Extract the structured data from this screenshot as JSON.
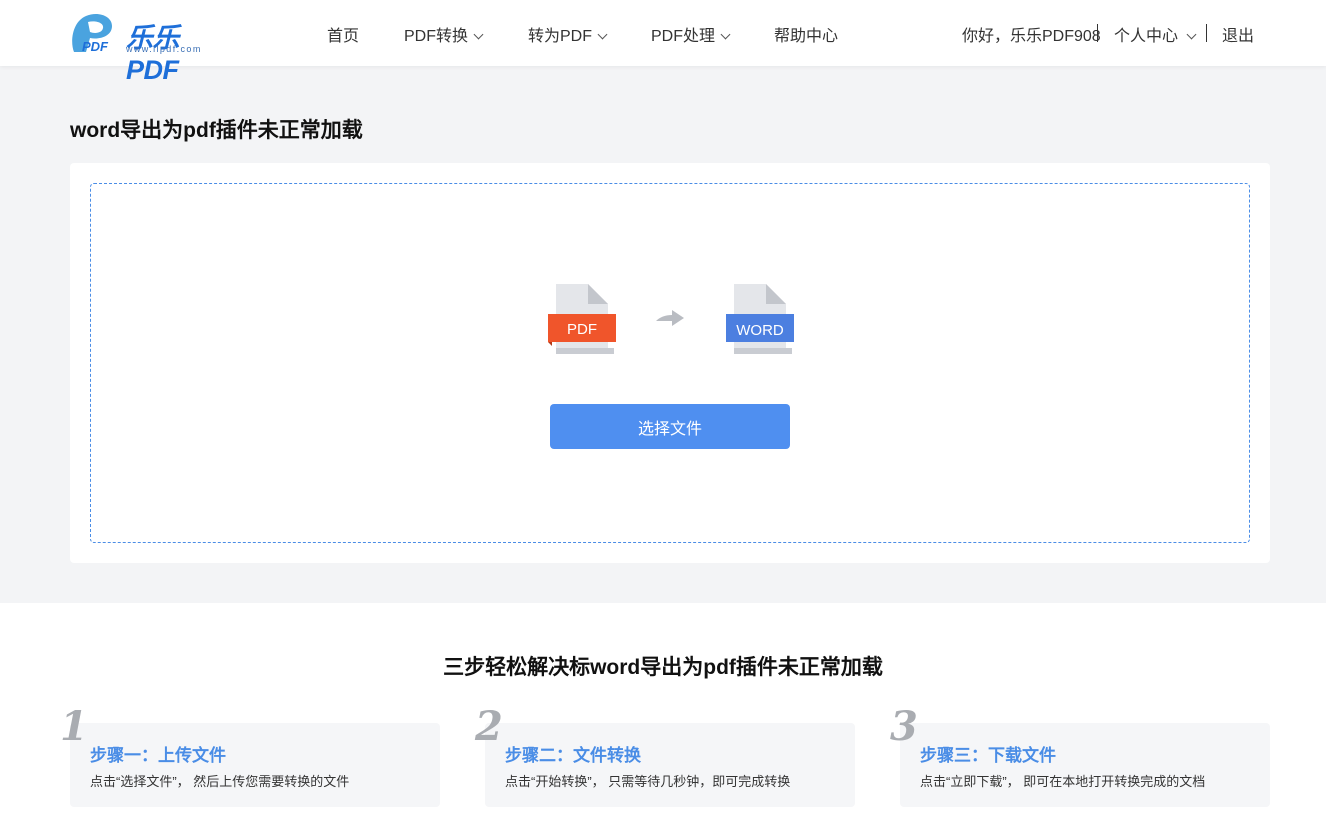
{
  "header": {
    "logo_text": "乐乐PDF",
    "logo_url": "www.llpdf.com",
    "nav": [
      {
        "label": "首页",
        "has_dropdown": false
      },
      {
        "label": "PDF转换",
        "has_dropdown": true
      },
      {
        "label": "转为PDF",
        "has_dropdown": true
      },
      {
        "label": "PDF处理",
        "has_dropdown": true
      },
      {
        "label": "帮助中心",
        "has_dropdown": false
      }
    ],
    "greeting": "你好，乐乐PDF908",
    "user_center": "个人中心",
    "logout": "退出"
  },
  "main": {
    "title": "word导出为pdf插件未正常加载",
    "source_label": "PDF",
    "target_label": "WORD",
    "select_button": "选择文件"
  },
  "steps": {
    "title": "三步轻松解决标word导出为pdf插件未正常加载",
    "items": [
      {
        "num": "1",
        "title": "步骤一：上传文件",
        "desc": "点击“选择文件”， 然后上传您需要转换的文件"
      },
      {
        "num": "2",
        "title": "步骤二：文件转换",
        "desc": "点击“开始转换”， 只需等待几秒钟，即可完成转换"
      },
      {
        "num": "3",
        "title": "步骤三：下载文件",
        "desc": "点击“立即下载”， 即可在本地打开转换完成的文档"
      }
    ]
  },
  "colors": {
    "accent": "#4f8ff0",
    "pdf": "#f0552b",
    "word": "#4c7fe0"
  }
}
